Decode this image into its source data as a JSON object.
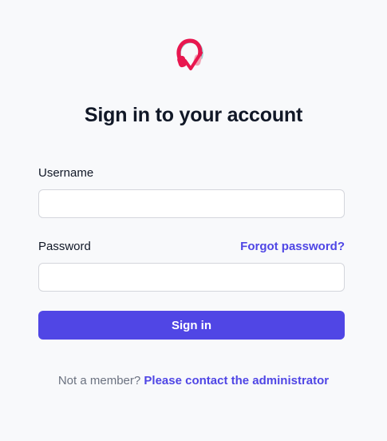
{
  "logo": {
    "icon": "headphones-heart-logo-icon",
    "primary_color": "#e8174f",
    "secondary_color": "#7fc8c8"
  },
  "title": "Sign in to your account",
  "form": {
    "username_label": "Username",
    "username_value": "",
    "password_label": "Password",
    "password_value": "",
    "forgot_password": "Forgot password?",
    "submit_label": "Sign in"
  },
  "footer": {
    "prompt": "Not a member?",
    "link_text": "Please contact the administrator"
  },
  "colors": {
    "accent": "#5046e5",
    "background": "#f8f9fb"
  }
}
